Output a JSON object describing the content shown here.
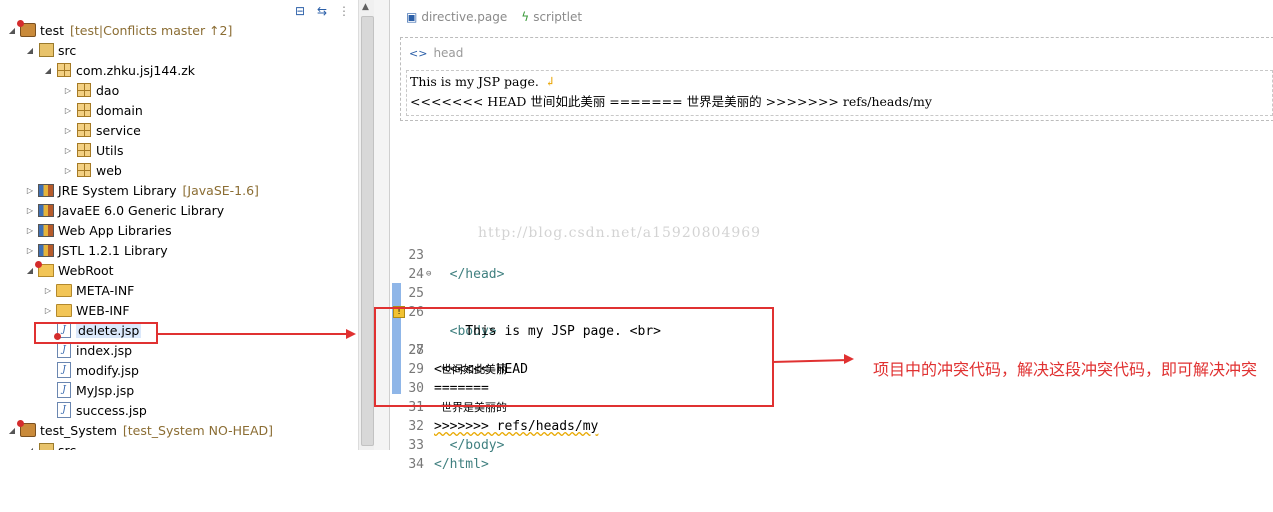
{
  "explorer": {
    "items": [
      {
        "label": "test",
        "decoration": "[test|Conflicts master ↑2]",
        "icon": "project-icon"
      },
      {
        "label": "src",
        "icon": "source-folder-icon"
      },
      {
        "label": "com.zhku.jsj144.zk",
        "icon": "package-icon"
      },
      {
        "label": "dao",
        "icon": "package-icon"
      },
      {
        "label": "domain",
        "icon": "package-icon"
      },
      {
        "label": "service",
        "icon": "package-icon"
      },
      {
        "label": "Utils",
        "icon": "package-icon"
      },
      {
        "label": "web",
        "icon": "package-icon"
      },
      {
        "label": "JRE System Library",
        "decoration": "[JavaSE-1.6]",
        "icon": "library-icon"
      },
      {
        "label": "JavaEE 6.0 Generic Library",
        "icon": "library-icon"
      },
      {
        "label": "Web App Libraries",
        "icon": "library-icon"
      },
      {
        "label": "JSTL 1.2.1 Library",
        "icon": "library-icon"
      },
      {
        "label": "WebRoot",
        "icon": "webroot-folder-icon"
      },
      {
        "label": "META-INF",
        "icon": "folder-icon"
      },
      {
        "label": "WEB-INF",
        "icon": "folder-icon"
      },
      {
        "label": "delete.jsp",
        "icon": "jsp-conflict-icon"
      },
      {
        "label": "index.jsp",
        "icon": "jsp-file-icon"
      },
      {
        "label": "modify.jsp",
        "icon": "jsp-file-icon"
      },
      {
        "label": "MyJsp.jsp",
        "icon": "jsp-file-icon"
      },
      {
        "label": "success.jsp",
        "icon": "jsp-file-icon"
      },
      {
        "label": "test_System",
        "decoration": "[test_System NO-HEAD]",
        "icon": "project-icon"
      },
      {
        "label": "src",
        "icon": "source-folder-icon"
      }
    ]
  },
  "design": {
    "palette": [
      "directive.page",
      "scriptlet"
    ],
    "head_tag": "head",
    "body_line1": "This is my JSP page.",
    "body_line2": "<<<<<<< HEAD 世间如此美丽 ======= 世界是美丽的 >>>>>>> refs/heads/my"
  },
  "code": {
    "lines": [
      {
        "num": "23",
        "text": "  </head>"
      },
      {
        "num": "24",
        "text": ""
      },
      {
        "num": "25",
        "text": "  <body>"
      },
      {
        "num": "26",
        "text": "    This is my JSP page. <br>"
      },
      {
        "num": "27",
        "text": "<<<<<<< HEAD"
      },
      {
        "num": "28",
        "text": "  世间如此美丽"
      },
      {
        "num": "29",
        "text": "======="
      },
      {
        "num": "30",
        "text": "  世界是美丽的"
      },
      {
        "num": "31",
        "text": ">>>>>>> refs/heads/my"
      },
      {
        "num": "32",
        "text": "  </body>"
      },
      {
        "num": "33",
        "text": "</html>"
      },
      {
        "num": "34",
        "text": ""
      }
    ]
  },
  "watermark": "http://blog.csdn.net/a15920804969",
  "annotation": {
    "note": "项目中的冲突代码，解决这段冲突代码，即可解决冲突",
    "color": "#e03131"
  }
}
